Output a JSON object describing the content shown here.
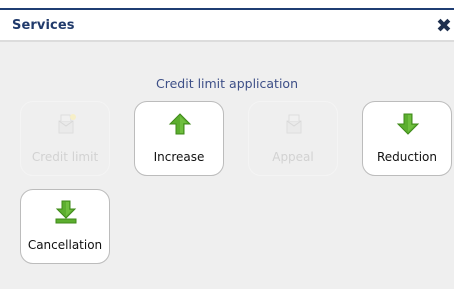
{
  "dialog": {
    "title": "Services",
    "close_glyph": "✖"
  },
  "section": {
    "heading": "Credit limit application"
  },
  "tiles": [
    {
      "label": "Credit limit",
      "icon": "document-star-icon",
      "enabled": false
    },
    {
      "label": "Increase",
      "icon": "arrow-up-icon",
      "enabled": true
    },
    {
      "label": "Appeal",
      "icon": "document-icon",
      "enabled": false
    },
    {
      "label": "Reduction",
      "icon": "arrow-down-icon",
      "enabled": true
    },
    {
      "label": "Cancellation",
      "icon": "arrow-down-bar-icon",
      "enabled": true
    }
  ],
  "colors": {
    "title": "#203a6b",
    "heading": "#3d4f87",
    "arrow_green": "#5cae2f",
    "disabled_text": "#d2d2d2"
  }
}
